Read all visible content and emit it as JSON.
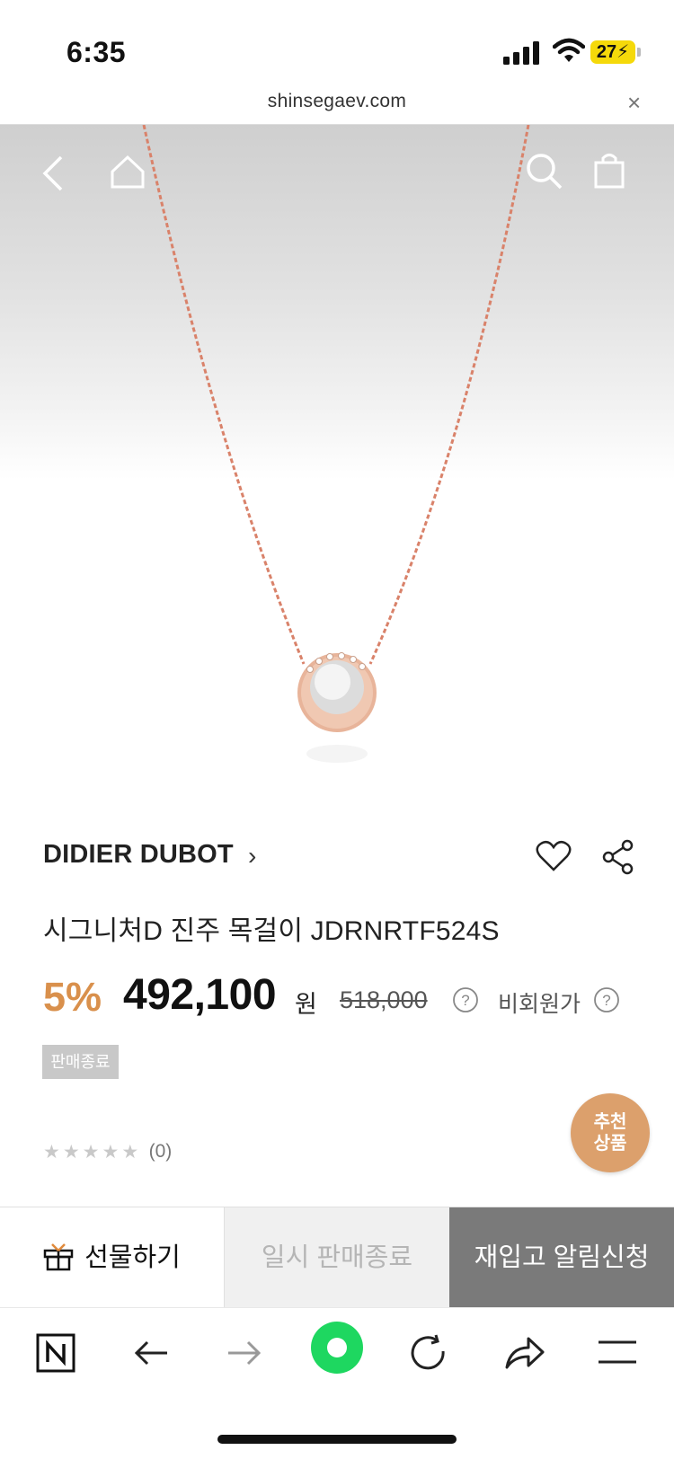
{
  "status_bar": {
    "time": "6:35",
    "battery": "27"
  },
  "browser": {
    "url": "shinsegaev.com",
    "close_glyph": "×"
  },
  "product": {
    "brand": "DIDIER DUBOT",
    "brand_chevron": "›",
    "title": "시그니처D 진주 목걸이 JDRNRTF524S",
    "discount": "5%",
    "price": "492,100",
    "currency": "원",
    "original_price": "518,000",
    "member_price_label": "비회원가",
    "help_glyph": "?",
    "badge": "판매종료",
    "rating_count": "(0)",
    "stars": [
      "★",
      "★",
      "★",
      "★",
      "★"
    ]
  },
  "floating": {
    "recommend_line1": "추천",
    "recommend_line2": "상품"
  },
  "actions": {
    "gift": "선물하기",
    "temp_soldout": "일시 판매종료",
    "restock": "재입고 알림신청"
  },
  "colors": {
    "accent": "#d9904c",
    "chain": "#d9826a",
    "recommend_bg": "#dca06c"
  },
  "icons": [
    "back-icon",
    "home-icon",
    "search-icon",
    "bag-icon",
    "heart-icon",
    "share-icon",
    "gift-icon",
    "naver-icon",
    "arrow-left-icon",
    "arrow-right-icon",
    "green-dot-icon",
    "reload-icon",
    "forward-share-icon",
    "menu-icon"
  ]
}
